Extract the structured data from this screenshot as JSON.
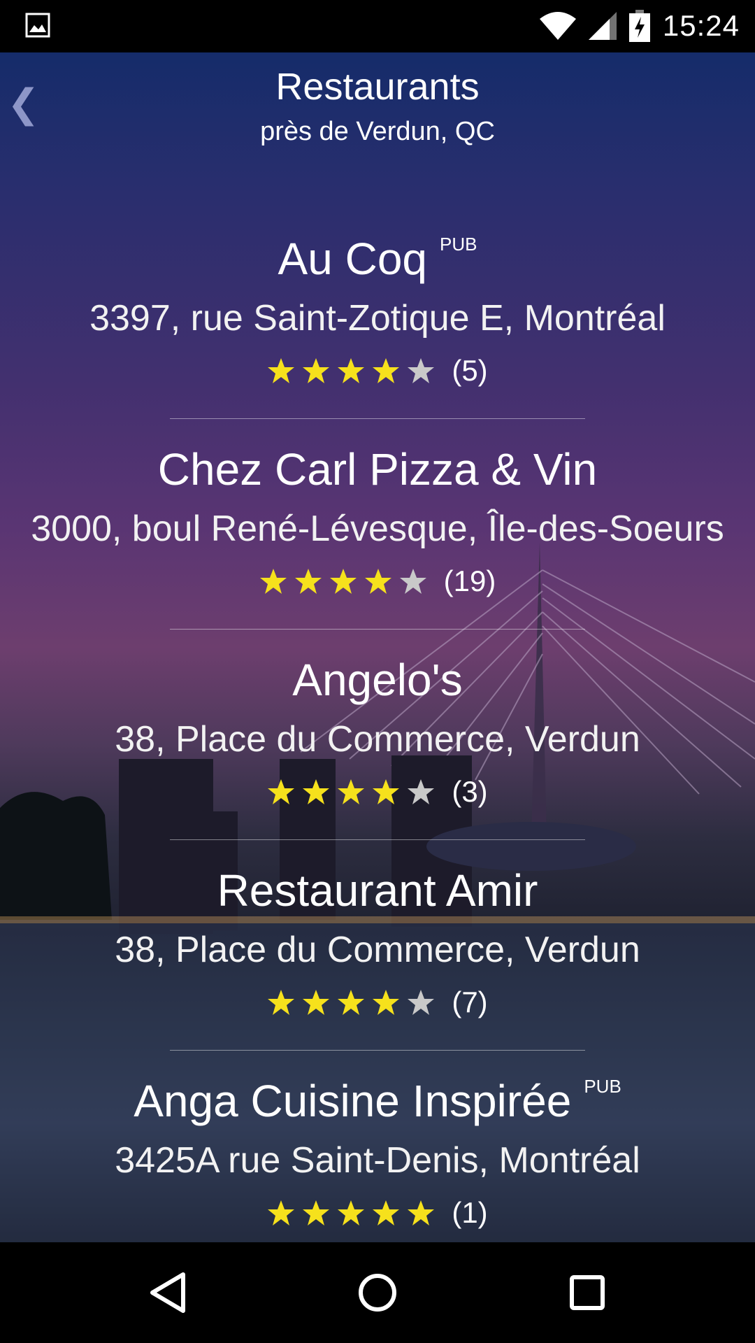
{
  "status_bar": {
    "time": "15:24"
  },
  "header": {
    "title": "Restaurants",
    "subtitle": "près de Verdun, QC",
    "back_glyph": "❮"
  },
  "restaurants": [
    {
      "name": "Au Coq",
      "badge": "PUB",
      "address": "3397, rue Saint-Zotique E, Montréal",
      "stars": 4,
      "reviews": "(5)"
    },
    {
      "name": "Chez Carl Pizza & Vin",
      "badge": "",
      "address": "3000, boul René-Lévesque, Île-des-Soeurs",
      "stars": 4,
      "reviews": "(19)"
    },
    {
      "name": "Angelo's",
      "badge": "",
      "address": "38, Place du Commerce, Verdun",
      "stars": 4,
      "reviews": "(3)"
    },
    {
      "name": "Restaurant Amir",
      "badge": "",
      "address": "38, Place du Commerce, Verdun",
      "stars": 4,
      "reviews": "(7)"
    },
    {
      "name": "Anga Cuisine Inspirée",
      "badge": "PUB",
      "address": "3425A rue Saint-Denis, Montréal",
      "stars": 5,
      "reviews": "(1)"
    }
  ],
  "colors": {
    "star_on": "#f6e11c",
    "star_off": "#c9c9c9"
  }
}
